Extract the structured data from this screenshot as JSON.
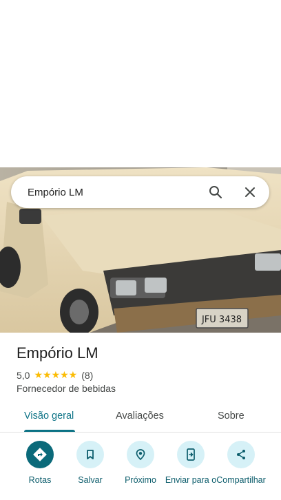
{
  "search": {
    "query": "Empório LM"
  },
  "place": {
    "name": "Empório LM",
    "rating_value": "5,0",
    "stars": "★★★★★",
    "review_count": "(8)",
    "category": "Fornecedor de bebidas"
  },
  "photo": {
    "plate_text": "JFU 3438"
  },
  "tabs": [
    {
      "label": "Visão geral",
      "active": true
    },
    {
      "label": "Avaliações",
      "active": false
    },
    {
      "label": "Sobre",
      "active": false
    }
  ],
  "actions": [
    {
      "label": "Rotas",
      "icon": "directions-icon"
    },
    {
      "label": "Salvar",
      "icon": "bookmark-icon"
    },
    {
      "label": "Próximo",
      "icon": "nearby-icon"
    },
    {
      "label": "Enviar para o",
      "icon": "send-to-phone-icon"
    },
    {
      "label": "Compartilhar",
      "icon": "share-icon"
    }
  ],
  "colors": {
    "accent": "#0b7285",
    "action_bg": "#d6f1f7",
    "star": "#fbbc04"
  }
}
